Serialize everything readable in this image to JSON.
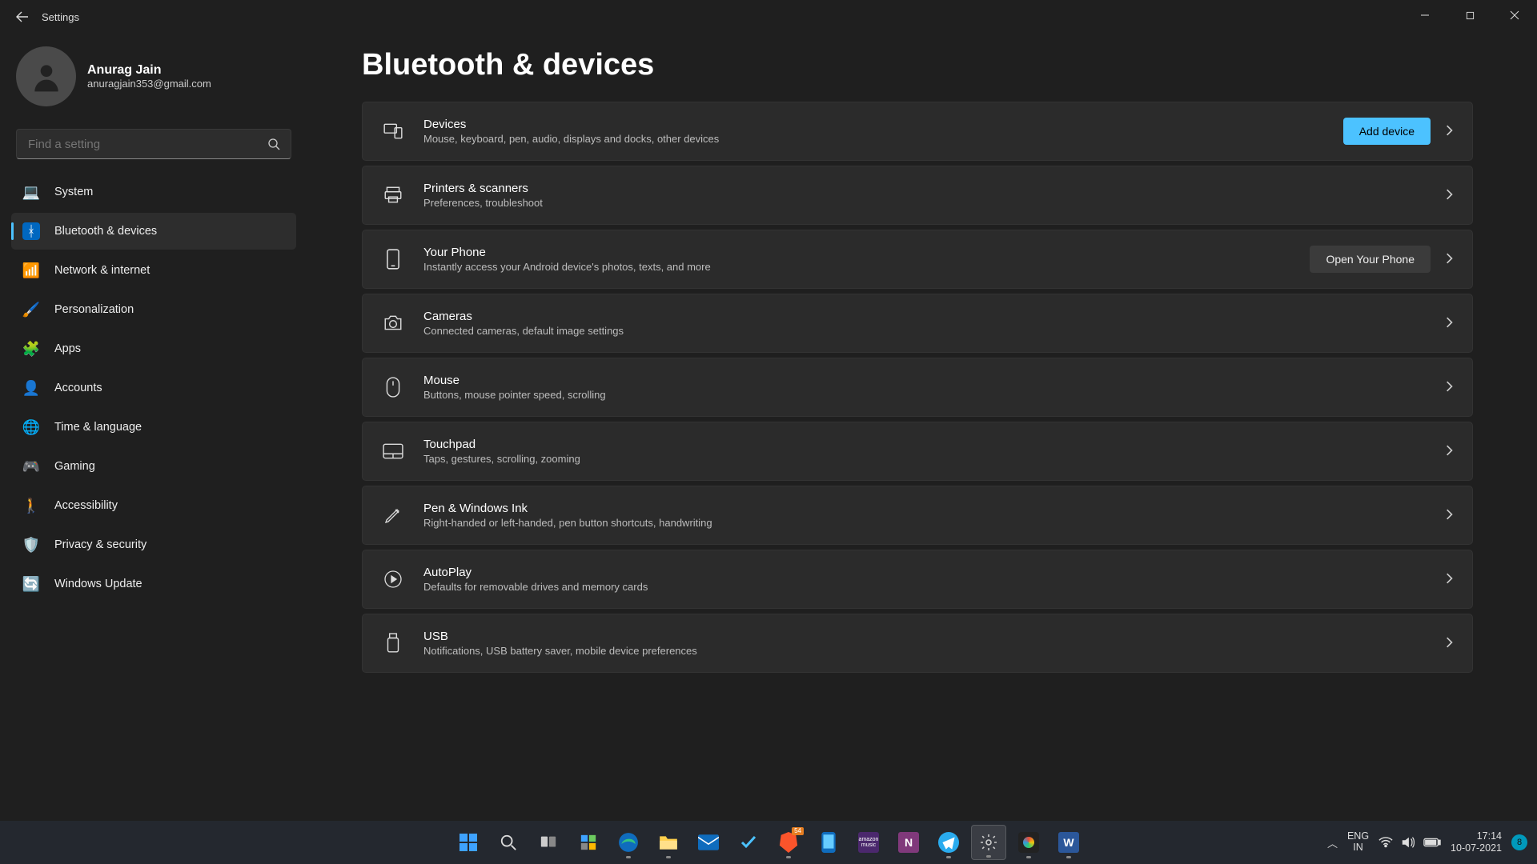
{
  "titlebar": {
    "title": "Settings"
  },
  "profile": {
    "name": "Anurag Jain",
    "email": "anuragjain353@gmail.com"
  },
  "search": {
    "placeholder": "Find a setting"
  },
  "nav": [
    {
      "label": "System",
      "icon": "💻"
    },
    {
      "label": "Bluetooth & devices",
      "icon": "bt",
      "active": true
    },
    {
      "label": "Network & internet",
      "icon": "📶"
    },
    {
      "label": "Personalization",
      "icon": "🖌️"
    },
    {
      "label": "Apps",
      "icon": "🧩"
    },
    {
      "label": "Accounts",
      "icon": "👤"
    },
    {
      "label": "Time & language",
      "icon": "🌐"
    },
    {
      "label": "Gaming",
      "icon": "🎮"
    },
    {
      "label": "Accessibility",
      "icon": "🚶"
    },
    {
      "label": "Privacy & security",
      "icon": "🛡️"
    },
    {
      "label": "Windows Update",
      "icon": "🔄"
    }
  ],
  "page": {
    "title": "Bluetooth & devices"
  },
  "buttons": {
    "add_device": "Add device",
    "open_phone": "Open Your Phone"
  },
  "cards": [
    {
      "title": "Devices",
      "sub": "Mouse, keyboard, pen, audio, displays and docks, other devices"
    },
    {
      "title": "Printers & scanners",
      "sub": "Preferences, troubleshoot"
    },
    {
      "title": "Your Phone",
      "sub": "Instantly access your Android device's photos, texts, and more"
    },
    {
      "title": "Cameras",
      "sub": "Connected cameras, default image settings"
    },
    {
      "title": "Mouse",
      "sub": "Buttons, mouse pointer speed, scrolling"
    },
    {
      "title": "Touchpad",
      "sub": "Taps, gestures, scrolling, zooming"
    },
    {
      "title": "Pen & Windows Ink",
      "sub": "Right-handed or left-handed, pen button shortcuts, handwriting"
    },
    {
      "title": "AutoPlay",
      "sub": "Defaults for removable drives and memory cards"
    },
    {
      "title": "USB",
      "sub": "Notifications, USB battery saver, mobile device preferences"
    }
  ],
  "taskbar": {
    "lang1": "ENG",
    "lang2": "IN",
    "time": "17:14",
    "date": "10-07-2021",
    "notif_count": "8",
    "brave_count": "54"
  }
}
